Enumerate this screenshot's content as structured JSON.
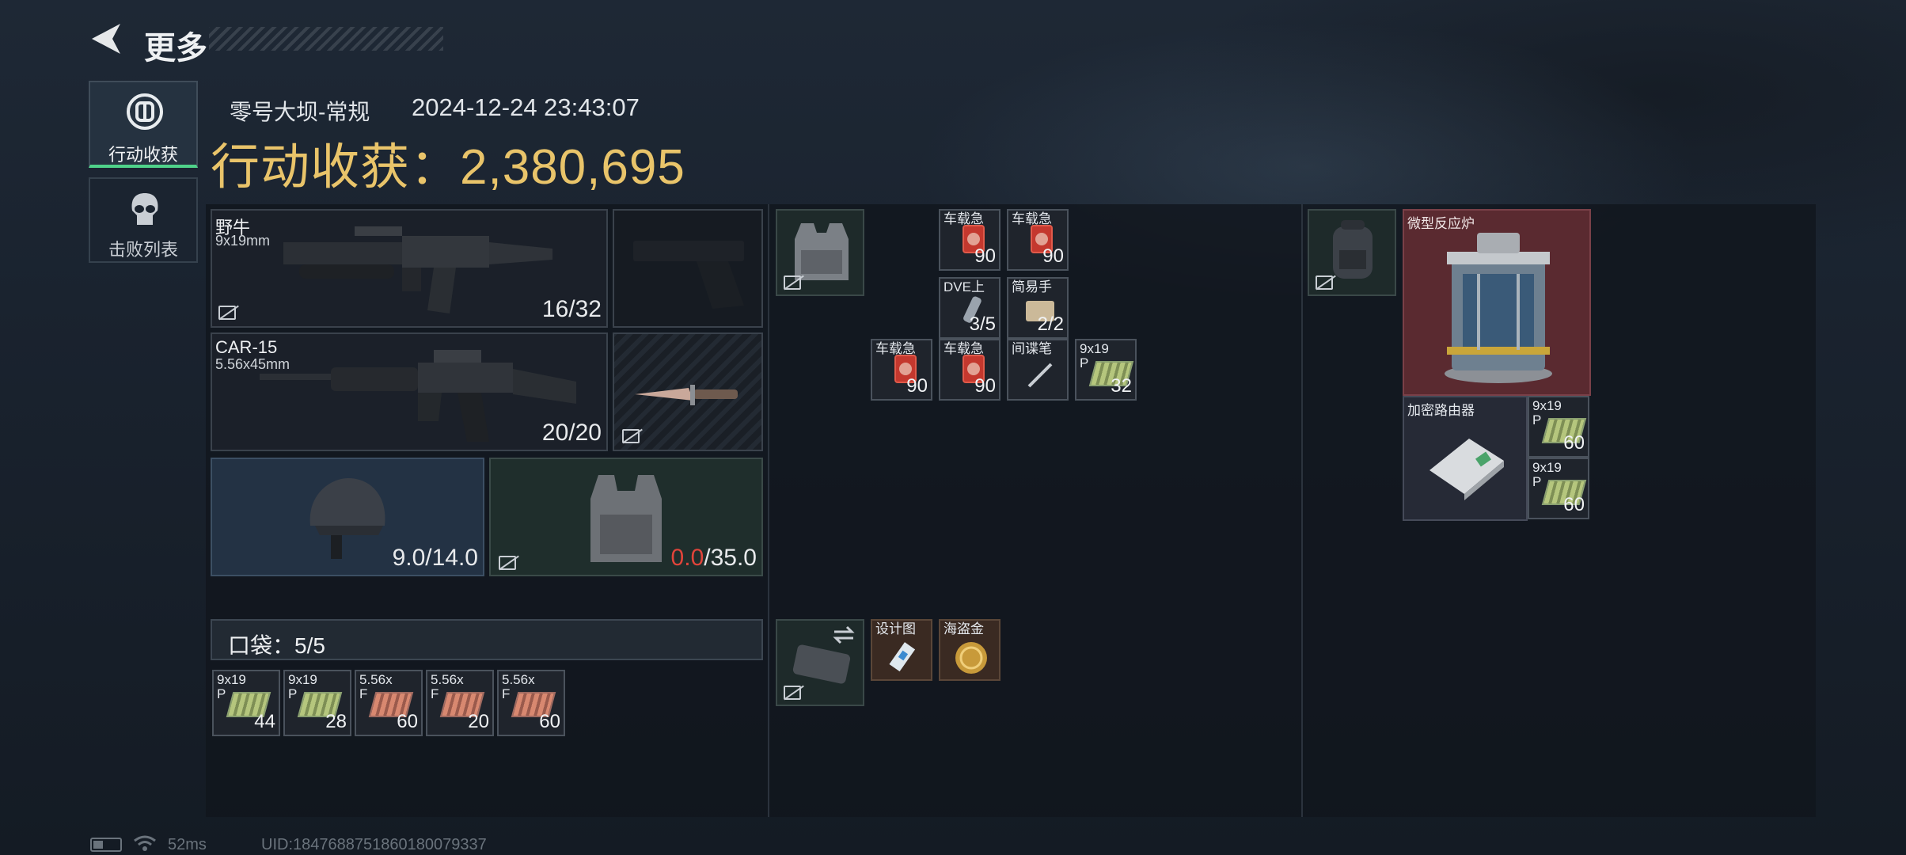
{
  "header": {
    "back_label": "更多"
  },
  "side_tabs": [
    {
      "label": "行动收获"
    },
    {
      "label": "击败列表"
    }
  ],
  "summary": {
    "map": "零号大坝-常规",
    "datetime": "2024-12-24 23:43:07",
    "title": "行动收获：2,380,695"
  },
  "weapons": [
    {
      "name": "野牛",
      "caliber": "9x19mm",
      "ammo": "16/32"
    },
    {
      "name": "CAR-15",
      "caliber": "5.56x45mm",
      "ammo": "20/20"
    }
  ],
  "armor": {
    "helmet": "9.0/14.0",
    "vest_current": "0.0",
    "vest_max": "/35.0"
  },
  "pockets": {
    "label": "口袋：5/5",
    "items": [
      {
        "l1": "9x19",
        "l2": "P",
        "count": "44"
      },
      {
        "l1": "9x19",
        "l2": "P",
        "count": "28"
      },
      {
        "l1": "5.56x",
        "l2": "F",
        "count": "60"
      },
      {
        "l1": "5.56x",
        "l2": "F",
        "count": "20"
      },
      {
        "l1": "5.56x",
        "l2": "F",
        "count": "60"
      }
    ]
  },
  "rig_items": [
    {
      "label": "车载急",
      "count": "90"
    },
    {
      "label": "车载急",
      "count": "90"
    },
    {
      "label": "DVE上",
      "count": "3/5"
    },
    {
      "label": "简易手",
      "count": "2/2"
    },
    {
      "label": "车载急",
      "count": "90"
    },
    {
      "label": "车载急",
      "count": "90"
    },
    {
      "label": "间谍笔",
      "count": ""
    },
    {
      "label": "9x19",
      "label2": "P",
      "count": "32"
    }
  ],
  "case_items": [
    {
      "label": "设计图"
    },
    {
      "label": "海盗金"
    }
  ],
  "backpack": {
    "reactor": "微型反应炉",
    "router": "加密路由器",
    "ammo": [
      {
        "l1": "9x19",
        "l2": "P",
        "count": "60"
      },
      {
        "l1": "9x19",
        "l2": "P",
        "count": "60"
      }
    ]
  },
  "footer": {
    "ping": "52ms",
    "uid": "UID:1847688751860180079337"
  },
  "colors": {
    "accent_gold": "#e9c46a",
    "accent_green": "#4fd28a",
    "warn_red": "#e0443a"
  }
}
